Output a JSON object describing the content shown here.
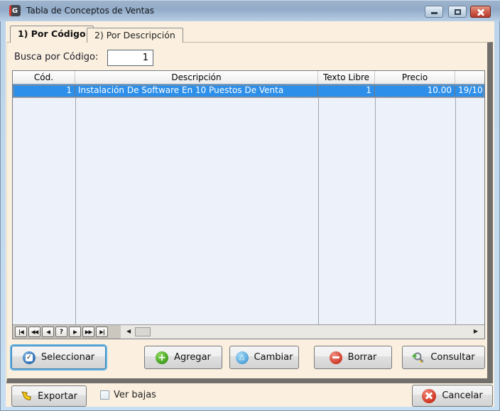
{
  "window": {
    "title": "Tabla de Conceptos de Ventas",
    "app_icon_letter": "G"
  },
  "tabs": [
    {
      "label": "1) Por Código",
      "active": true
    },
    {
      "label": "2) Por Descripción",
      "active": false
    }
  ],
  "search": {
    "label": "Busca por Código:",
    "value": "1"
  },
  "grid": {
    "columns": [
      {
        "label": "Cód.",
        "align": "right"
      },
      {
        "label": "Descripción",
        "align": "left"
      },
      {
        "label": "Texto Libre",
        "align": "right"
      },
      {
        "label": "Precio",
        "align": "right"
      },
      {
        "label": "",
        "align": "left"
      }
    ],
    "rows": [
      {
        "selected": true,
        "cells": [
          "1",
          "Instalación De Software En 10 Puestos De Venta",
          "1",
          "10.00",
          "19/10"
        ]
      }
    ]
  },
  "navigator": {
    "buttons": [
      {
        "name": "first",
        "glyph": "|◀"
      },
      {
        "name": "fast-prior",
        "glyph": "◀◀"
      },
      {
        "name": "prior",
        "glyph": "◀"
      },
      {
        "name": "help",
        "glyph": "?"
      },
      {
        "name": "next",
        "glyph": "▶"
      },
      {
        "name": "fast-next",
        "glyph": "▶▶"
      },
      {
        "name": "last",
        "glyph": "▶|"
      }
    ]
  },
  "scrollbar": {
    "left_arrow": "◀",
    "right_arrow": "▶"
  },
  "actions": [
    {
      "label": "Seleccionar",
      "icon": "checkbox-icon",
      "focused": true
    },
    {
      "label": "Agregar",
      "icon": "plus-icon"
    },
    {
      "label": "Cambiar",
      "icon": "delta-icon"
    },
    {
      "label": "Borrar",
      "icon": "minus-icon"
    },
    {
      "label": "Consultar",
      "icon": "magnifier-icon"
    }
  ],
  "icons": {
    "check_glyph": "✓",
    "plus_glyph": "+",
    "delta_glyph": "△"
  },
  "footer": {
    "export_label": "Exportar",
    "checkbox_label": "Ver bajas",
    "checkbox_checked": false,
    "cancel_label": "Cancelar"
  },
  "colors": {
    "titlebar_top": "#92ABC8",
    "titlebar_bottom": "#BACFE6",
    "client_bg": "#FBF0DF",
    "grid_body": "#EDF1FA",
    "selected_row": "#2D8FE9",
    "focus_ring": "#62B2E3",
    "close_button": "#D0634F",
    "panel_shadow": "#716F6B"
  }
}
